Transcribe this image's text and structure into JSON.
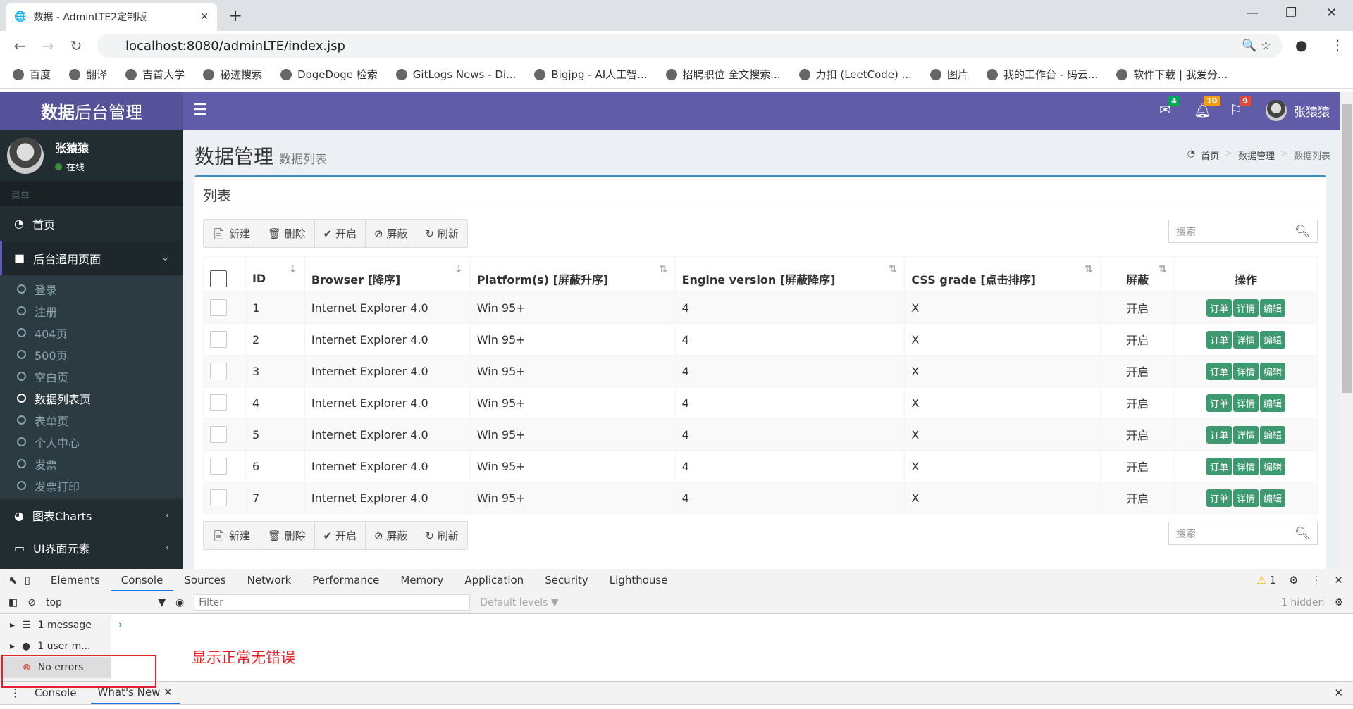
{
  "browser": {
    "tab_title": "数据 - AdminLTE2定制版",
    "url": "localhost:8080/adminLTE/index.jsp",
    "bookmarks": [
      "百度",
      "翻译",
      "吉首大学",
      "秘迹搜索",
      "DogeDoge 检索",
      "GitLogs News - Di...",
      "Bigjpg - AI人工智...",
      "招聘职位 全文搜索...",
      "力扣 (LeetCode) ...",
      "图片",
      "我的工作台 - 码云...",
      "软件下载 | 我爱分..."
    ]
  },
  "header": {
    "logo_bold": "数据",
    "logo_rest": "后台管理",
    "mail_count": "4",
    "bell_count": "10",
    "flag_count": "9",
    "user": "张猿猿",
    "colors": {
      "header": "#605ca8",
      "logo": "#555299"
    }
  },
  "sidebar": {
    "user": "张猿猿",
    "status": "在线",
    "menu_header": "菜单",
    "home": "首页",
    "group": "后台通用页面",
    "sub": [
      "登录",
      "注册",
      "404页",
      "500页",
      "空白页",
      "数据列表页",
      "表单页",
      "个人中心",
      "发票",
      "发票打印"
    ],
    "active_sub": "数据列表页",
    "charts": "图表Charts",
    "ui": "UI界面元素"
  },
  "page": {
    "title": "数据管理",
    "subtitle": "数据列表",
    "breadcrumb": [
      "首页",
      "数据管理",
      "数据列表"
    ],
    "box_title": "列表",
    "toolbar": [
      "新建",
      "删除",
      "开启",
      "屏蔽",
      "刷新"
    ],
    "search_placeholder": "搜索",
    "columns": [
      "ID",
      "Browser [降序]",
      "Platform(s) [屏蔽升序]",
      "Engine version [屏蔽降序]",
      "CSS grade [点击排序]",
      "屏蔽",
      "操作"
    ],
    "actions": [
      "订单",
      "详情",
      "编辑"
    ],
    "rows": [
      {
        "id": "1",
        "browser": "Internet Explorer 4.0",
        "platform": "Win 95+",
        "engine": "4",
        "css": "X",
        "status": "开启"
      },
      {
        "id": "2",
        "browser": "Internet Explorer 4.0",
        "platform": "Win 95+",
        "engine": "4",
        "css": "X",
        "status": "开启"
      },
      {
        "id": "3",
        "browser": "Internet Explorer 4.0",
        "platform": "Win 95+",
        "engine": "4",
        "css": "X",
        "status": "开启"
      },
      {
        "id": "4",
        "browser": "Internet Explorer 4.0",
        "platform": "Win 95+",
        "engine": "4",
        "css": "X",
        "status": "开启"
      },
      {
        "id": "5",
        "browser": "Internet Explorer 4.0",
        "platform": "Win 95+",
        "engine": "4",
        "css": "X",
        "status": "开启"
      },
      {
        "id": "6",
        "browser": "Internet Explorer 4.0",
        "platform": "Win 95+",
        "engine": "4",
        "css": "X",
        "status": "开启"
      },
      {
        "id": "7",
        "browser": "Internet Explorer 4.0",
        "platform": "Win 95+",
        "engine": "4",
        "css": "X",
        "status": "开启"
      }
    ]
  },
  "devtools": {
    "tabs": [
      "Elements",
      "Console",
      "Sources",
      "Network",
      "Performance",
      "Memory",
      "Application",
      "Security",
      "Lighthouse"
    ],
    "active_tab": "Console",
    "warning_count": "1",
    "context": "top",
    "filter_placeholder": "Filter",
    "levels": "Default levels ▼",
    "hidden": "1 hidden",
    "sidebar": [
      "1 message",
      "1 user m...",
      "No errors"
    ],
    "bottom_tabs": [
      "Console",
      "What's New"
    ],
    "annotation": "显示正常无错误"
  }
}
